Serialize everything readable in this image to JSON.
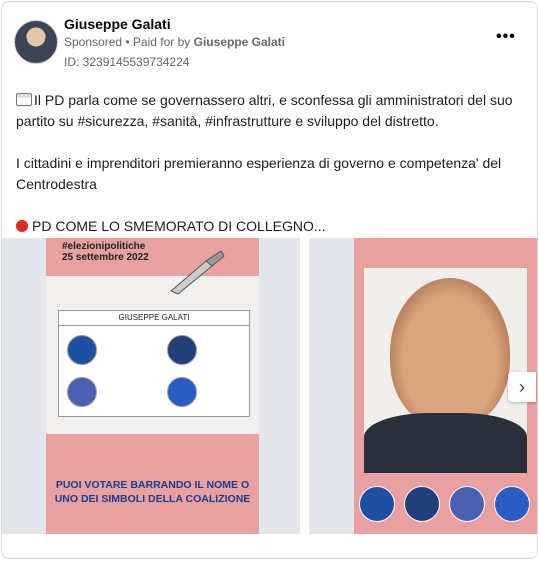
{
  "post": {
    "author": "Giuseppe Galati",
    "sponsored": "Sponsored",
    "paid_by_prefix": "Paid for by",
    "paid_by": "Giuseppe Galati",
    "ad_id": "ID: 3239145539734224",
    "more_label": "•••",
    "text_line1": "Il PD parla come se governassero altri, e sconfessa gli amministratori del suo partito su #sicurezza, #sanità, #infrastrutture e sviluppo del distretto.",
    "text_line2": "I cittadini e imprenditori premieranno esperienza di governo e competenza' del Centrodestra",
    "text_line3": "PD COME LO SMEMORATO DI COLLEGNO..."
  },
  "carousel": {
    "card1": {
      "hashtag": "#elezionipolitiche",
      "date": "25 settembre 2022",
      "ballot_name": "GIUSEPPE GALATI",
      "cta": "PUOI VOTARE BARRANDO IL NOME O UNO DEI SIMBOLI DELLA COALIZIONE"
    },
    "next_label": "›"
  },
  "colors": {
    "pink": "#e9a0a0",
    "blue_text": "#1a3c8c"
  },
  "icons": [
    "newspaper-icon",
    "red-circle-icon",
    "more-icon",
    "chevron-right-icon"
  ]
}
